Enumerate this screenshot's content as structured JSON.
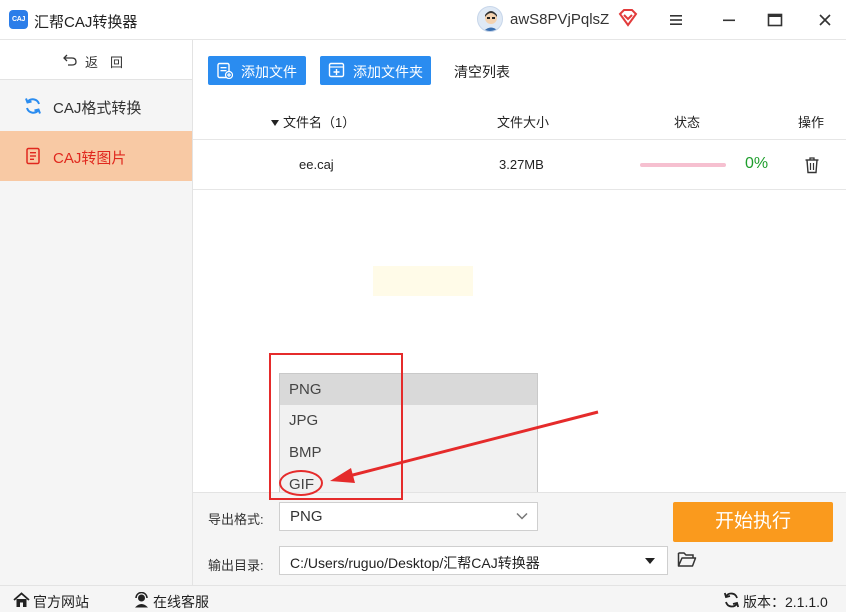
{
  "window": {
    "logo_text": "CAJ",
    "title": "汇帮CAJ转换器",
    "username": "awS8PVjPqlsZ"
  },
  "sidebar": {
    "back_label": "返回",
    "items": [
      {
        "label": "CAJ格式转换",
        "active": false
      },
      {
        "label": "CAJ转图片",
        "active": true
      }
    ]
  },
  "toolbar": {
    "add_file": "添加文件",
    "add_folder": "添加文件夹",
    "clear_list": "清空列表"
  },
  "table": {
    "headers": {
      "name": "文件名（1）",
      "size": "文件大小",
      "status": "状态",
      "action": "操作"
    },
    "rows": [
      {
        "name": "ee.caj",
        "size": "3.27MB",
        "progress": 0,
        "percent": "0%"
      }
    ]
  },
  "dropdown": {
    "options": [
      "PNG",
      "JPG",
      "BMP",
      "GIF"
    ],
    "highlighted": "PNG"
  },
  "settings": {
    "format_label": "导出格式:",
    "format_value": "PNG",
    "output_label": "输出目录:",
    "output_value": "C:/Users/ruguo/Desktop/汇帮CAJ转换器",
    "start_button": "开始执行"
  },
  "footer": {
    "site": "官方网站",
    "service": "在线客服",
    "version": "版本：2.1.1.0"
  },
  "colors": {
    "accent_blue": "#2a8cf0",
    "active_nav_bg": "#f8c9a4",
    "active_nav_text": "#e0281e",
    "start_orange": "#fa9a1d",
    "percent_green": "#1e9e2c",
    "annotation_red": "#e52b2b"
  }
}
